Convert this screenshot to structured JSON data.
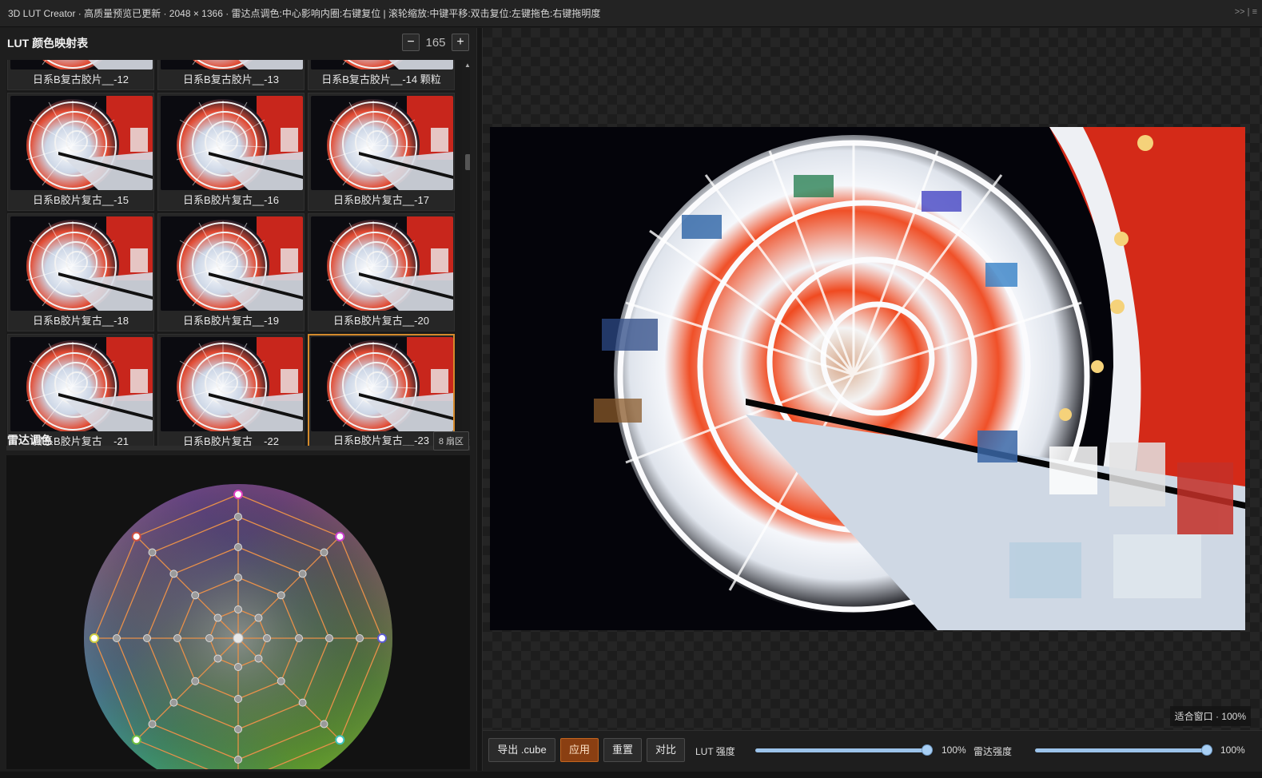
{
  "window": {
    "title": "3D LUT Creator · 高质量预览已更新 · 2048 × 1366 · 雷达点调色:中心影响内圈:右键复位 | 滚轮缩放:中键平移:双击复位:左键拖色:右键拖明度",
    "controls": ">> | ≡"
  },
  "lut_panel": {
    "title": "LUT 颜色映射表",
    "minus_label": "−",
    "count": "165",
    "plus_label": "+",
    "items": [
      {
        "label": "日系B复古胶片__-12"
      },
      {
        "label": "日系B复古胶片__-13"
      },
      {
        "label": "日系B复古胶片__-14 颗粒"
      },
      {
        "label": "日系B胶片复古__-15"
      },
      {
        "label": "日系B胶片复古__-16"
      },
      {
        "label": "日系B胶片复古__-17"
      },
      {
        "label": "日系B胶片复古__-18"
      },
      {
        "label": "日系B胶片复古__-19"
      },
      {
        "label": "日系B胶片复古__-20"
      },
      {
        "label": "日系B胶片复古__-21"
      },
      {
        "label": "日系B胶片复古__-22"
      },
      {
        "label": "日系B胶片复古__-23"
      }
    ],
    "selected_index": 11
  },
  "radar_panel": {
    "title": "雷达调色",
    "sectors": "8 扇区"
  },
  "preview": {
    "fit_label": "适合窗口 · 100%"
  },
  "toolbar": {
    "export_label": "导出 .cube",
    "apply_label": "应用",
    "reset_label": "重置",
    "compare_label": "对比",
    "lut_strength_label": "LUT 强度",
    "lut_strength_value": "100%",
    "lut_strength": 1.0,
    "radar_strength_label": "雷达强度",
    "radar_strength_value": "100%",
    "radar_strength": 1.0
  },
  "colors": {
    "accent": "#d48a2c",
    "apply_button": "#8a3f12",
    "slider": "#9cc3ea",
    "radar_lines": "#e8904a"
  }
}
